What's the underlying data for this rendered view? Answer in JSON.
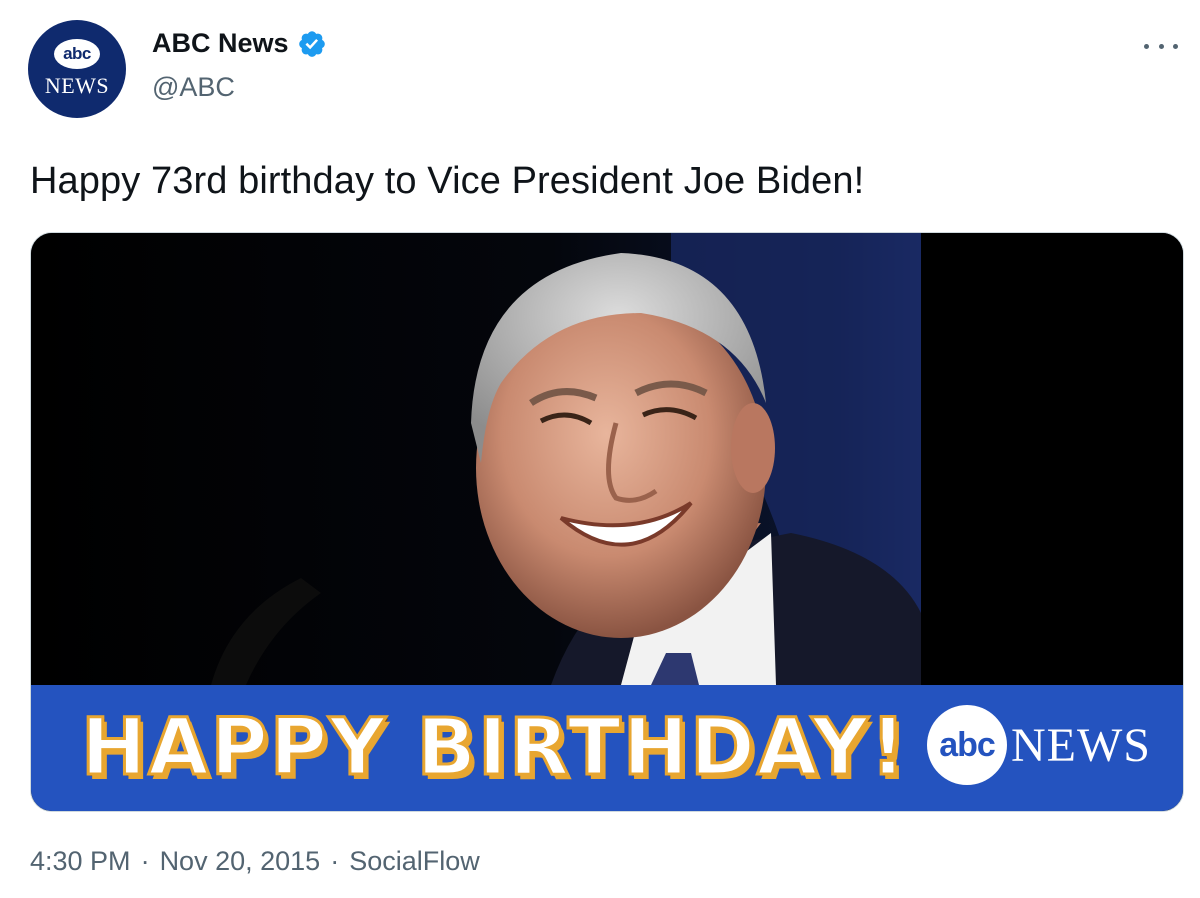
{
  "author": {
    "display_name": "ABC News",
    "handle": "@ABC",
    "avatar_logo_text": "abc",
    "avatar_subtext": "NEWS",
    "verified": true,
    "verified_icon": "verified-badge-icon"
  },
  "menu": {
    "icon": "more-dots-icon"
  },
  "tweet": {
    "text": "Happy 73rd birthday to Vice President Joe Biden!"
  },
  "media": {
    "banner_text": "HAPPY BIRTHDAY!",
    "banner_logo_abc": "abc",
    "banner_logo_news": "NEWS",
    "banner_color": "#2453bf",
    "banner_text_outline": "#e8a630"
  },
  "meta": {
    "time": "4:30 PM",
    "separator": "·",
    "date": "Nov 20, 2015",
    "source": "SocialFlow"
  },
  "colors": {
    "accent_verified": "#1d9bf0",
    "text_primary": "#0f1419",
    "text_secondary": "#536471",
    "avatar_bg": "#0f2a6e"
  }
}
